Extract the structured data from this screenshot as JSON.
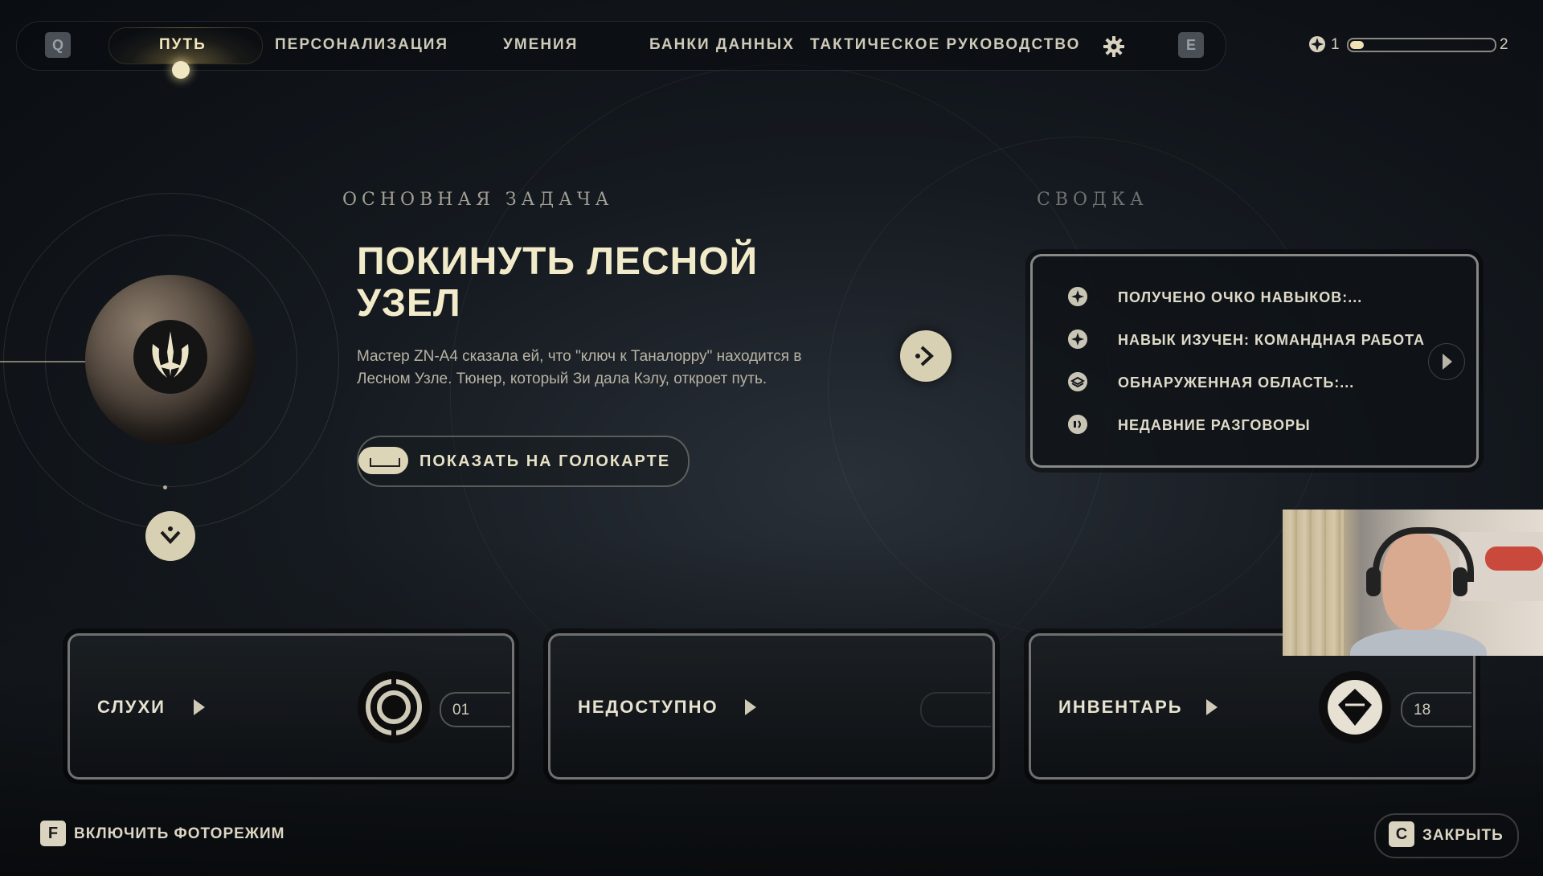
{
  "nav": {
    "left_key": "Q",
    "right_key": "E",
    "tabs": [
      {
        "label": "ПУТЬ",
        "active": true
      },
      {
        "label": "ПЕРСОНАЛИЗАЦИЯ",
        "active": false
      },
      {
        "label": "УМЕНИЯ",
        "active": false
      },
      {
        "label": "БАНКИ ДАННЫХ",
        "active": false
      },
      {
        "label": "ТАКТИЧЕСКОЕ РУКОВОДСТВО",
        "active": false
      }
    ],
    "settings_icon": "gear-icon"
  },
  "level": {
    "current": "1",
    "next": "2",
    "progress": 0.1,
    "icon": "skill-point-icon"
  },
  "objective": {
    "label": "ОСНОВНАЯ ЗАДАЧА",
    "title": "ПОКИНУТЬ ЛЕСНОЙ УЗЕЛ",
    "description": "Мастер ZN-A4 сказала ей, что \"ключ к Таналорру\" находится в Лесном Узле. Тюнер, который Зи дала Кэлу, откроет путь.",
    "holomap_button": "ПОКАЗАТЬ НА ГОЛОКАРТЕ",
    "planet_icon": "jedi-order-emblem-icon"
  },
  "summary": {
    "label": "СВОДКА",
    "items": [
      {
        "text": "ПОЛУЧЕНО ОЧКО НАВЫКОВ:...",
        "icon": "skill-point-icon"
      },
      {
        "text": "НАВЫК ИЗУЧЕН: КОМАНДНАЯ РАБОТА",
        "icon": "skill-point-icon"
      },
      {
        "text": "ОБНАРУЖЕННАЯ ОБЛАСТЬ:...",
        "icon": "area-icon"
      },
      {
        "text": "НЕДАВНИЕ РАЗГОВОРЫ",
        "icon": "conversation-icon"
      }
    ]
  },
  "cards": [
    {
      "title": "СЛУХИ",
      "count": "01",
      "icon": "rumors-icon"
    },
    {
      "title": "НЕДОСТУПНО",
      "count": "",
      "icon": ""
    },
    {
      "title": "ИНВЕНТАРЬ",
      "count": "18",
      "icon": "inventory-gem-icon"
    }
  ],
  "footer": {
    "photo_key": "F",
    "photo_label": "ВКЛЮЧИТЬ ФОТОРЕЖИМ",
    "close_key": "C",
    "close_label": "ЗАКРЫТЬ"
  },
  "colors": {
    "accent": "#f2ebc9",
    "button_fill": "#d8d0b2",
    "background": "#151a20"
  }
}
